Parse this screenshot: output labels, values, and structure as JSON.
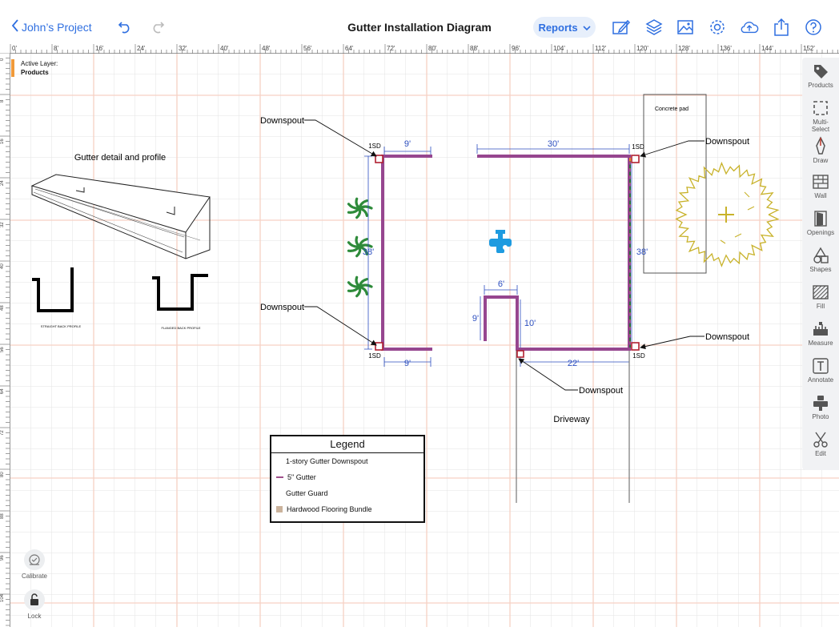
{
  "header": {
    "back_label": "John’s Project",
    "title": "Gutter Installation Diagram",
    "reports_label": "Reports"
  },
  "ruler": {
    "top_ticks": [
      "0'",
      "8'",
      "16'",
      "24'",
      "32'",
      "40'",
      "48'",
      "56'",
      "64'",
      "72'",
      "80'",
      "88'",
      "96'",
      "104'",
      "112'",
      "120'",
      "128'",
      "136'",
      "144'",
      "152'"
    ],
    "left_ticks": [
      "0",
      "8",
      "16",
      "24",
      "32",
      "40",
      "48",
      "56",
      "64",
      "72",
      "80",
      "88",
      "96",
      "104"
    ]
  },
  "active_layer": {
    "label": "Active Layer:",
    "value": "Products"
  },
  "tools": [
    {
      "label": "Products",
      "icon": "tag-icon"
    },
    {
      "label": "Multi-Select",
      "icon": "multi-select-icon"
    },
    {
      "label": "Draw",
      "icon": "pen-icon"
    },
    {
      "label": "Wall",
      "icon": "brick-wall-icon"
    },
    {
      "label": "Openings",
      "icon": "door-icon"
    },
    {
      "label": "Shapes",
      "icon": "shapes-icon"
    },
    {
      "label": "Fill",
      "icon": "hatch-fill-icon"
    },
    {
      "label": "Measure",
      "icon": "ruler-icon"
    },
    {
      "label": "Annotate",
      "icon": "text-box-icon"
    },
    {
      "label": "Photo",
      "icon": "camera-pin-icon"
    },
    {
      "label": "Edit",
      "icon": "scissors-icon"
    }
  ],
  "bottom_tools": {
    "calibrate": "Calibrate",
    "lock": "Lock"
  },
  "drawing": {
    "gutter_detail_title": "Gutter detail and profile",
    "straight_profile": "STRAIGHT BACK PROFILE",
    "flanged_profile": "FLANGED BACK PROFILE",
    "concrete_pad": "Concrete pad",
    "driveway": "Driveway",
    "downspout": "Downspout",
    "sd": "1SD",
    "dims": {
      "top_left": "9'",
      "left_side": "38'",
      "bottom_left": "9'",
      "top_right": "30'",
      "right_side": "38'",
      "bottom_right": "22'",
      "bay_width": "6'",
      "bay_left": "9'",
      "bay_right": "10'"
    }
  },
  "legend": {
    "title": "Legend",
    "items": [
      {
        "label": "1-story Gutter Downspout",
        "swatch": "none"
      },
      {
        "label": "5\" Gutter",
        "swatch": "#a0508c"
      },
      {
        "label": "Gutter Guard",
        "swatch": "none"
      },
      {
        "label": "Hardwood Flooring Bundle",
        "swatch": "#cbb39c"
      }
    ]
  },
  "colors": {
    "accent": "#2f6fe0",
    "gutter": "#96468f",
    "dimension": "#2d4fc0",
    "major_grid": "#f6d1c4",
    "minor_grid": "#e3e3e3",
    "downspout": "#b02030",
    "plant": "#2e8b3a",
    "tree": "#c8b22a",
    "layer_marker": "#f09a3a"
  }
}
